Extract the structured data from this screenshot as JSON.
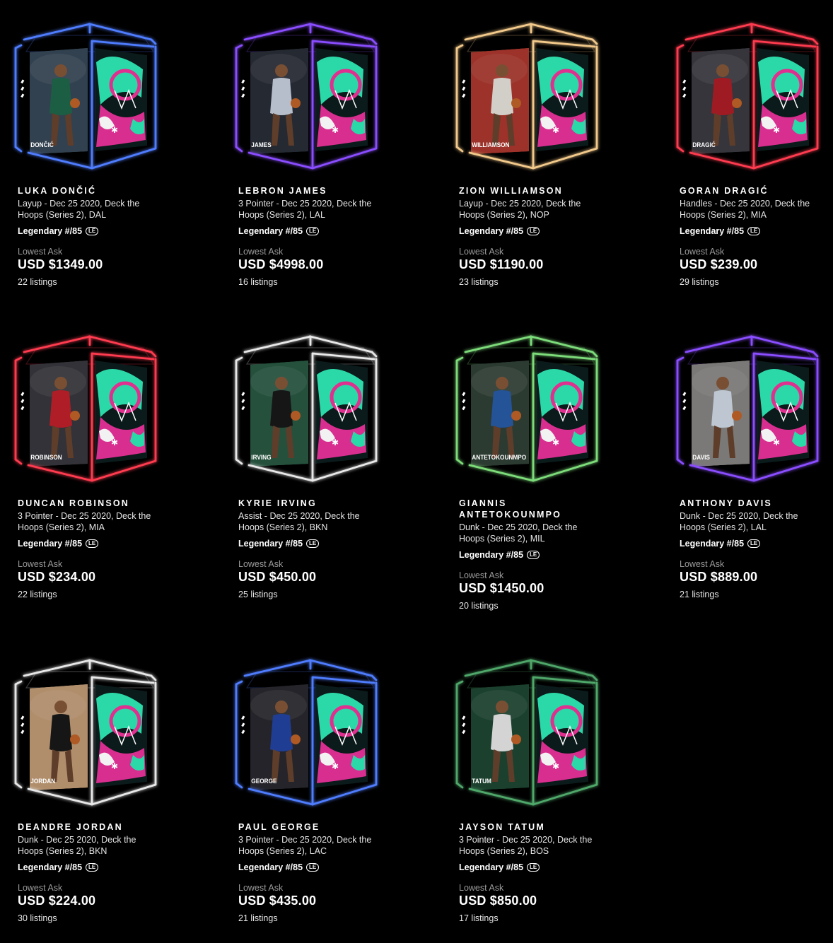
{
  "moments": [
    {
      "player": "Luka Dončić",
      "play": "Layup - Dec 25 2020, Deck the Hoops (Series 2), DAL",
      "tier": "Legendary #/85",
      "badge": "LE",
      "lowest_ask_label": "Lowest Ask",
      "price": "USD $1349.00",
      "listings": "22 listings",
      "card_name": "DONČIĆ",
      "glow": "#4f7dff",
      "jersey": "#1f6b4e",
      "bg": "#3a4a5a"
    },
    {
      "player": "LeBron James",
      "play": "3 Pointer - Dec 25 2020, Deck the Hoops (Series 2), LAL",
      "tier": "Legendary #/85",
      "badge": "LE",
      "lowest_ask_label": "Lowest Ask",
      "price": "USD $4998.00",
      "listings": "16 listings",
      "card_name": "JAMES",
      "glow": "#8a4dff",
      "jersey": "#cfd9e6",
      "bg": "#2a2f3a"
    },
    {
      "player": "Zion Williamson",
      "play": "Layup - Dec 25 2020, Deck the Hoops (Series 2), NOP",
      "tier": "Legendary #/85",
      "badge": "LE",
      "lowest_ask_label": "Lowest Ask",
      "price": "USD $1190.00",
      "listings": "23 listings",
      "card_name": "WILLIAMSON",
      "glow": "#f2c98a",
      "jersey": "#f0ece4",
      "bg": "#b23a2f"
    },
    {
      "player": "Goran Dragić",
      "play": "Handles - Dec 25 2020, Deck the Hoops (Series 2), MIA",
      "tier": "Legendary #/85",
      "badge": "LE",
      "lowest_ask_label": "Lowest Ask",
      "price": "USD $239.00",
      "listings": "29 listings",
      "card_name": "DRAGIĆ",
      "glow": "#ff3b4f",
      "jersey": "#b51f2a",
      "bg": "#3d3d44"
    },
    {
      "player": "Duncan Robinson",
      "play": "3 Pointer - Dec 25 2020, Deck the Hoops (Series 2), MIA",
      "tier": "Legendary #/85",
      "badge": "LE",
      "lowest_ask_label": "Lowest Ask",
      "price": "USD $234.00",
      "listings": "22 listings",
      "card_name": "ROBINSON",
      "glow": "#ff3b4f",
      "jersey": "#c8222c",
      "bg": "#3a3a40"
    },
    {
      "player": "Kyrie Irving",
      "play": "Assist - Dec 25 2020, Deck the Hoops (Series 2), BKN",
      "tier": "Legendary #/85",
      "badge": "LE",
      "lowest_ask_label": "Lowest Ask",
      "price": "USD $450.00",
      "listings": "25 listings",
      "card_name": "IRVING",
      "glow": "#e8e8e8",
      "jersey": "#1a1a1a",
      "bg": "#2b5c45"
    },
    {
      "player": "Giannis Antetokounmpo",
      "play": "Dunk - Dec 25 2020, Deck the Hoops (Series 2), MIL",
      "tier": "Legendary #/85",
      "badge": "LE",
      "lowest_ask_label": "Lowest Ask",
      "price": "USD $1450.00",
      "listings": "20 listings",
      "card_name": "ANTETOKOUNMPO",
      "glow": "#7ddc7a",
      "jersey": "#2a5fae",
      "bg": "#33443a"
    },
    {
      "player": "Anthony Davis",
      "play": "Dunk - Dec 25 2020, Deck the Hoops (Series 2), LAL",
      "tier": "Legendary #/85",
      "badge": "LE",
      "lowest_ask_label": "Lowest Ask",
      "price": "USD $889.00",
      "listings": "21 listings",
      "card_name": "DAVIS",
      "glow": "#8a4dff",
      "jersey": "#d8e2ee",
      "bg": "#8c8a88"
    },
    {
      "player": "DeAndre Jordan",
      "play": "Dunk - Dec 25 2020, Deck the Hoops (Series 2), BKN",
      "tier": "Legendary #/85",
      "badge": "LE",
      "lowest_ask_label": "Lowest Ask",
      "price": "USD $224.00",
      "listings": "30 listings",
      "card_name": "JORDAN",
      "glow": "#e8e8e8",
      "jersey": "#1a1a1a",
      "bg": "#c9a27a"
    },
    {
      "player": "Paul George",
      "play": "3 Pointer - Dec 25 2020, Deck the Hoops (Series 2), LAC",
      "tier": "Legendary #/85",
      "badge": "LE",
      "lowest_ask_label": "Lowest Ask",
      "price": "USD $435.00",
      "listings": "21 listings",
      "card_name": "GEORGE",
      "glow": "#4f7dff",
      "jersey": "#2447a8",
      "bg": "#2a2a30"
    },
    {
      "player": "Jayson Tatum",
      "play": "3 Pointer - Dec 25 2020, Deck the Hoops (Series 2), BOS",
      "tier": "Legendary #/85",
      "badge": "LE",
      "lowest_ask_label": "Lowest Ask",
      "price": "USD $850.00",
      "listings": "17 listings",
      "card_name": "TATUM",
      "glow": "#4fa86a",
      "jersey": "#f2f2f2",
      "bg": "#1f4a35"
    }
  ]
}
